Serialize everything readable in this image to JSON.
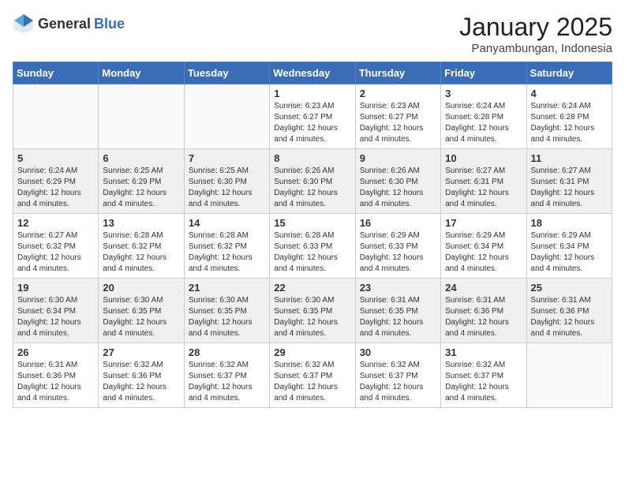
{
  "header": {
    "logo_general": "General",
    "logo_blue": "Blue",
    "month_title": "January 2025",
    "location": "Panyambungan, Indonesia"
  },
  "weekdays": [
    "Sunday",
    "Monday",
    "Tuesday",
    "Wednesday",
    "Thursday",
    "Friday",
    "Saturday"
  ],
  "weeks": [
    [
      {
        "day": "",
        "sunrise": "",
        "sunset": "",
        "daylight": ""
      },
      {
        "day": "",
        "sunrise": "",
        "sunset": "",
        "daylight": ""
      },
      {
        "day": "",
        "sunrise": "",
        "sunset": "",
        "daylight": ""
      },
      {
        "day": "1",
        "sunrise": "Sunrise: 6:23 AM",
        "sunset": "Sunset: 6:27 PM",
        "daylight": "Daylight: 12 hours and 4 minutes."
      },
      {
        "day": "2",
        "sunrise": "Sunrise: 6:23 AM",
        "sunset": "Sunset: 6:27 PM",
        "daylight": "Daylight: 12 hours and 4 minutes."
      },
      {
        "day": "3",
        "sunrise": "Sunrise: 6:24 AM",
        "sunset": "Sunset: 6:28 PM",
        "daylight": "Daylight: 12 hours and 4 minutes."
      },
      {
        "day": "4",
        "sunrise": "Sunrise: 6:24 AM",
        "sunset": "Sunset: 6:28 PM",
        "daylight": "Daylight: 12 hours and 4 minutes."
      }
    ],
    [
      {
        "day": "5",
        "sunrise": "Sunrise: 6:24 AM",
        "sunset": "Sunset: 6:29 PM",
        "daylight": "Daylight: 12 hours and 4 minutes."
      },
      {
        "day": "6",
        "sunrise": "Sunrise: 6:25 AM",
        "sunset": "Sunset: 6:29 PM",
        "daylight": "Daylight: 12 hours and 4 minutes."
      },
      {
        "day": "7",
        "sunrise": "Sunrise: 6:25 AM",
        "sunset": "Sunset: 6:30 PM",
        "daylight": "Daylight: 12 hours and 4 minutes."
      },
      {
        "day": "8",
        "sunrise": "Sunrise: 6:26 AM",
        "sunset": "Sunset: 6:30 PM",
        "daylight": "Daylight: 12 hours and 4 minutes."
      },
      {
        "day": "9",
        "sunrise": "Sunrise: 6:26 AM",
        "sunset": "Sunset: 6:30 PM",
        "daylight": "Daylight: 12 hours and 4 minutes."
      },
      {
        "day": "10",
        "sunrise": "Sunrise: 6:27 AM",
        "sunset": "Sunset: 6:31 PM",
        "daylight": "Daylight: 12 hours and 4 minutes."
      },
      {
        "day": "11",
        "sunrise": "Sunrise: 6:27 AM",
        "sunset": "Sunset: 6:31 PM",
        "daylight": "Daylight: 12 hours and 4 minutes."
      }
    ],
    [
      {
        "day": "12",
        "sunrise": "Sunrise: 6:27 AM",
        "sunset": "Sunset: 6:32 PM",
        "daylight": "Daylight: 12 hours and 4 minutes."
      },
      {
        "day": "13",
        "sunrise": "Sunrise: 6:28 AM",
        "sunset": "Sunset: 6:32 PM",
        "daylight": "Daylight: 12 hours and 4 minutes."
      },
      {
        "day": "14",
        "sunrise": "Sunrise: 6:28 AM",
        "sunset": "Sunset: 6:32 PM",
        "daylight": "Daylight: 12 hours and 4 minutes."
      },
      {
        "day": "15",
        "sunrise": "Sunrise: 6:28 AM",
        "sunset": "Sunset: 6:33 PM",
        "daylight": "Daylight: 12 hours and 4 minutes."
      },
      {
        "day": "16",
        "sunrise": "Sunrise: 6:29 AM",
        "sunset": "Sunset: 6:33 PM",
        "daylight": "Daylight: 12 hours and 4 minutes."
      },
      {
        "day": "17",
        "sunrise": "Sunrise: 6:29 AM",
        "sunset": "Sunset: 6:34 PM",
        "daylight": "Daylight: 12 hours and 4 minutes."
      },
      {
        "day": "18",
        "sunrise": "Sunrise: 6:29 AM",
        "sunset": "Sunset: 6:34 PM",
        "daylight": "Daylight: 12 hours and 4 minutes."
      }
    ],
    [
      {
        "day": "19",
        "sunrise": "Sunrise: 6:30 AM",
        "sunset": "Sunset: 6:34 PM",
        "daylight": "Daylight: 12 hours and 4 minutes."
      },
      {
        "day": "20",
        "sunrise": "Sunrise: 6:30 AM",
        "sunset": "Sunset: 6:35 PM",
        "daylight": "Daylight: 12 hours and 4 minutes."
      },
      {
        "day": "21",
        "sunrise": "Sunrise: 6:30 AM",
        "sunset": "Sunset: 6:35 PM",
        "daylight": "Daylight: 12 hours and 4 minutes."
      },
      {
        "day": "22",
        "sunrise": "Sunrise: 6:30 AM",
        "sunset": "Sunset: 6:35 PM",
        "daylight": "Daylight: 12 hours and 4 minutes."
      },
      {
        "day": "23",
        "sunrise": "Sunrise: 6:31 AM",
        "sunset": "Sunset: 6:35 PM",
        "daylight": "Daylight: 12 hours and 4 minutes."
      },
      {
        "day": "24",
        "sunrise": "Sunrise: 6:31 AM",
        "sunset": "Sunset: 6:36 PM",
        "daylight": "Daylight: 12 hours and 4 minutes."
      },
      {
        "day": "25",
        "sunrise": "Sunrise: 6:31 AM",
        "sunset": "Sunset: 6:36 PM",
        "daylight": "Daylight: 12 hours and 4 minutes."
      }
    ],
    [
      {
        "day": "26",
        "sunrise": "Sunrise: 6:31 AM",
        "sunset": "Sunset: 6:36 PM",
        "daylight": "Daylight: 12 hours and 4 minutes."
      },
      {
        "day": "27",
        "sunrise": "Sunrise: 6:32 AM",
        "sunset": "Sunset: 6:36 PM",
        "daylight": "Daylight: 12 hours and 4 minutes."
      },
      {
        "day": "28",
        "sunrise": "Sunrise: 6:32 AM",
        "sunset": "Sunset: 6:37 PM",
        "daylight": "Daylight: 12 hours and 4 minutes."
      },
      {
        "day": "29",
        "sunrise": "Sunrise: 6:32 AM",
        "sunset": "Sunset: 6:37 PM",
        "daylight": "Daylight: 12 hours and 4 minutes."
      },
      {
        "day": "30",
        "sunrise": "Sunrise: 6:32 AM",
        "sunset": "Sunset: 6:37 PM",
        "daylight": "Daylight: 12 hours and 4 minutes."
      },
      {
        "day": "31",
        "sunrise": "Sunrise: 6:32 AM",
        "sunset": "Sunset: 6:37 PM",
        "daylight": "Daylight: 12 hours and 4 minutes."
      },
      {
        "day": "",
        "sunrise": "",
        "sunset": "",
        "daylight": ""
      }
    ]
  ]
}
